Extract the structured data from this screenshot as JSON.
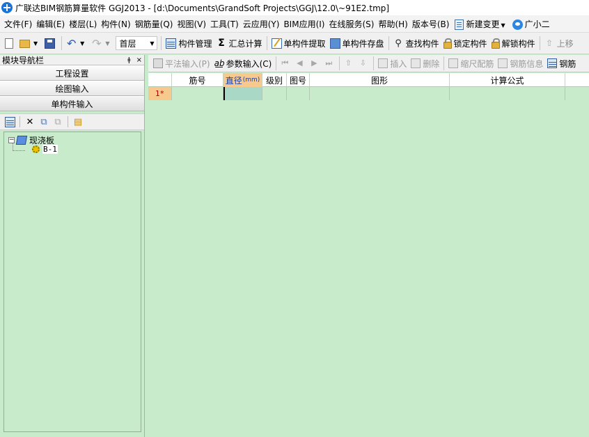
{
  "window": {
    "title": "广联达BIM钢筋算量软件 GGJ2013 - [d:\\Documents\\GrandSoft Projects\\GGJ\\12.0\\~91E2.tmp]"
  },
  "menu": {
    "items": [
      "文件(F)",
      "编辑(E)",
      "楼层(L)",
      "构件(N)",
      "钢筋量(Q)",
      "视图(V)",
      "工具(T)",
      "云应用(Y)",
      "BIM应用(I)",
      "在线服务(S)",
      "帮助(H)",
      "版本号(B)"
    ],
    "new_change": "新建变更",
    "assistant": "广小二"
  },
  "toolbar": {
    "floor": "首层",
    "component_mgmt": "构件管理",
    "summary_calc": "汇总计算",
    "single_extract": "单构件提取",
    "single_save": "单构件存盘",
    "find_component": "查找构件",
    "lock_component": "锁定构件",
    "unlock_component": "解锁构件",
    "move_up": "上移"
  },
  "nav": {
    "header": "模块导航栏",
    "pin": "ǂ",
    "close": "×",
    "buttons": [
      "工程设置",
      "绘图输入",
      "单构件输入"
    ],
    "tree": {
      "root": "现浇板",
      "child": "B-1"
    }
  },
  "grid_toolbar": {
    "flat_input": "平法输入(P)",
    "param_input": "参数输入(C)",
    "insert": "插入",
    "delete": "删除",
    "scale_rebar": "缩尺配筋",
    "rebar_info": "钢筋信息",
    "rebar_more": "钢筋"
  },
  "grid": {
    "columns": [
      "",
      "筋号",
      "直径",
      "级别",
      "图号",
      "图形",
      "计算公式",
      ""
    ],
    "active_unit": "(mm)",
    "row_label": "1*"
  }
}
